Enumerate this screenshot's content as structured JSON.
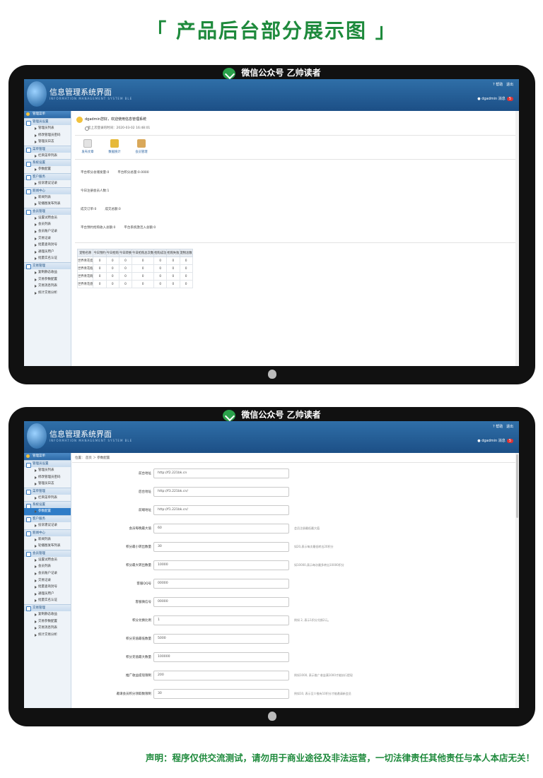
{
  "page_title": "「 产品后台部分展示图 」",
  "brand_banner": "微信公众号 乙帅读者",
  "app": {
    "title": "信息管理系统界面",
    "subtitle": "INFORMATION MANAGEMENT SYSTEM BLE",
    "help": "帮助",
    "logout": "退出",
    "user": "dgadmin",
    "messages_label": "消息",
    "messages_count": "5"
  },
  "sidebar": {
    "top": "管理菜单",
    "sections": [
      {
        "title": "管理员设置",
        "items": [
          "管理员列表",
          "修改管理员密码",
          "管理员日志"
        ]
      },
      {
        "title": "菜单管理",
        "items": [
          "栏目菜单列表"
        ]
      },
      {
        "title": "系统设置",
        "items": [
          "参数配置"
        ]
      },
      {
        "title": "客户服务",
        "items": [
          "投诉建议记录"
        ]
      },
      {
        "title": "新闻中心",
        "items": [
          "新闻列表",
          "轮播图发布列表"
        ]
      },
      {
        "title": "会员管理",
        "items": [
          "设置试用会员",
          "会员列表",
          "会员账户记录",
          "交易记录",
          "批量查询封号",
          "通理员用户",
          "批量实名认证"
        ]
      },
      {
        "title": "交易管理",
        "items": [
          "复制静态收益",
          "交易参数配置",
          "交易消息列表",
          "统计交易分析"
        ]
      }
    ]
  },
  "dashboard": {
    "welcome": "dgadmin您好，欢迎使用信息管理系统",
    "last_login": "您上次登录的时间：2020-03-02 16:48:01",
    "quick_links": [
      "发布文章",
      "数据统计",
      "会员管理"
    ],
    "stats": [
      [
        "平台积分总储发量:0",
        "平台积分总量:0.0000"
      ],
      [
        "今日注册会员人数:1"
      ],
      [
        "成交订单:0",
        "成交总额:0"
      ],
      [
        "平台预约抢购收入总额:0",
        "平台系统激活入总额:0"
      ]
    ],
    "table": {
      "headers": [
        "宠物名称",
        "今日预约",
        "今日抢购",
        "今日转换",
        "今日抢购总次数",
        "抢购成功",
        "抢购失败",
        "宠物总数"
      ],
      "rows": [
        [
          "世界青花瓷",
          "0",
          "0",
          "0",
          "0",
          "0",
          "0",
          "0"
        ],
        [
          "世界青花瓶",
          "0",
          "0",
          "0",
          "0",
          "0",
          "0",
          "0"
        ],
        [
          "世界青花碗",
          "0",
          "0",
          "0",
          "0",
          "0",
          "0",
          "0"
        ],
        [
          "世界青花盘",
          "0",
          "0",
          "0",
          "0",
          "0",
          "0",
          "0"
        ]
      ]
    }
  },
  "config": {
    "breadcrumb": "位置： 首页 ＞ 参数配置",
    "fields": [
      {
        "label": "前台地址",
        "value": "http://f2.221bk.cn",
        "hint": ""
      },
      {
        "label": "后台地址",
        "value": "http://f3.221bk.cn/",
        "hint": ""
      },
      {
        "label": "前端地址",
        "value": "http://f1.221bk.cn/",
        "hint": ""
      },
      {
        "label": "会员每晚最大值",
        "value": "60",
        "hint": "会员注册最低最大值"
      },
      {
        "label": "积分最小转出数量",
        "value": "30",
        "hint": "如20,表示每次最低转出20积分"
      },
      {
        "label": "积分最大转出数量",
        "value": "10000",
        "hint": "如10000,表示每次最多转出10000积分"
      },
      {
        "label": "客服QQ号",
        "value": "00000",
        "hint": ""
      },
      {
        "label": "客服微信号",
        "value": "00000",
        "hint": ""
      },
      {
        "label": "积分兑换比例",
        "value": "1",
        "hint": "例如 2, 表示1积分兑换2元。"
      },
      {
        "label": "积分充值最低数量",
        "value": "5000",
        "hint": ""
      },
      {
        "label": "积分充值最大数量",
        "value": "100000",
        "hint": ""
      },
      {
        "label": "推广收益提现限制",
        "value": "200",
        "hint": "例如1000, 表示推广收益满1000才能执行提现"
      },
      {
        "label": "邀请会员积分领取数限制",
        "value": "30",
        "hint": "例如10, 表示至少推有10积分才能邀请新会员"
      }
    ]
  },
  "disclaimer": "声明：程序仅供交流测试，请勿用于商业途径及非法运营，一切法律责任其他责任与本人本店无关！"
}
